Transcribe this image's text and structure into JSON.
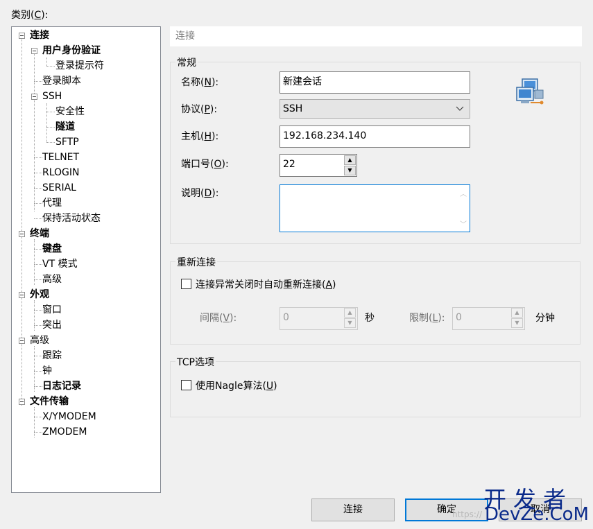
{
  "category_label": "类别(C):",
  "category_label_parts": {
    "pre": "类别(",
    "key": "C",
    "post": "):"
  },
  "tree": {
    "items": [
      {
        "label": "连接",
        "bold": true
      },
      {
        "label": "用户身份验证",
        "bold": true
      },
      {
        "label": "登录提示符",
        "bold": false
      },
      {
        "label": "登录脚本",
        "bold": false
      },
      {
        "label": "SSH",
        "bold": false
      },
      {
        "label": "安全性",
        "bold": false
      },
      {
        "label": "隧道",
        "bold": true
      },
      {
        "label": "SFTP",
        "bold": false
      },
      {
        "label": "TELNET",
        "bold": false
      },
      {
        "label": "RLOGIN",
        "bold": false
      },
      {
        "label": "SERIAL",
        "bold": false
      },
      {
        "label": "代理",
        "bold": false
      },
      {
        "label": "保持活动状态",
        "bold": false
      },
      {
        "label": "终端",
        "bold": true
      },
      {
        "label": "键盘",
        "bold": true
      },
      {
        "label": "VT 模式",
        "bold": false
      },
      {
        "label": "高级",
        "bold": false
      },
      {
        "label": "外观",
        "bold": true
      },
      {
        "label": "窗口",
        "bold": false
      },
      {
        "label": "突出",
        "bold": false
      },
      {
        "label": "高级",
        "bold": false
      },
      {
        "label": "跟踪",
        "bold": false
      },
      {
        "label": "钟",
        "bold": false
      },
      {
        "label": "日志记录",
        "bold": true
      },
      {
        "label": "文件传输",
        "bold": true
      },
      {
        "label": "X/YMODEM",
        "bold": false
      },
      {
        "label": "ZMODEM",
        "bold": false
      }
    ]
  },
  "header": {
    "title": "连接"
  },
  "general": {
    "title": "常规",
    "name_label": {
      "pre": "名称(",
      "key": "N",
      "post": "):"
    },
    "name_value": "新建会话",
    "protocol_label": {
      "pre": "协议(",
      "key": "P",
      "post": "):"
    },
    "protocol_value": "SSH",
    "host_label": {
      "pre": "主机(",
      "key": "H",
      "post": "):"
    },
    "host_value": "192.168.234.140",
    "port_label": {
      "pre": "端口号(",
      "key": "O",
      "post": "):"
    },
    "port_value": "22",
    "desc_label": {
      "pre": "说明(",
      "key": "D",
      "post": "):"
    },
    "desc_value": ""
  },
  "reconnect": {
    "title": "重新连接",
    "auto_label": {
      "pre": "连接异常关闭时自动重新连接(",
      "key": "A",
      "post": ")"
    },
    "auto_checked": false,
    "interval_label": {
      "pre": "间隔(",
      "key": "V",
      "post": "):"
    },
    "interval_value": "0",
    "interval_unit": "秒",
    "limit_label": {
      "pre": "限制(",
      "key": "L",
      "post": "):"
    },
    "limit_value": "0",
    "limit_unit": "分钟"
  },
  "tcp": {
    "title": "TCP选项",
    "nagle_label": {
      "pre": "使用Nagle算法(",
      "key": "U",
      "post": ")"
    },
    "nagle_checked": false
  },
  "buttons": {
    "connect": "连接",
    "ok": "确定",
    "cancel": "取消"
  },
  "watermark": {
    "cn": "开发者",
    "en": "DevZe.CoM",
    "url": "https://"
  },
  "icons": {
    "network": "network-computers-icon",
    "expander": "tree-collapse-icon",
    "dropdown": "chevron-down-icon"
  },
  "colors": {
    "focus_border": "#0078d7",
    "window_bg": "#f0f0f0",
    "watermark": "#0a2a8a"
  }
}
